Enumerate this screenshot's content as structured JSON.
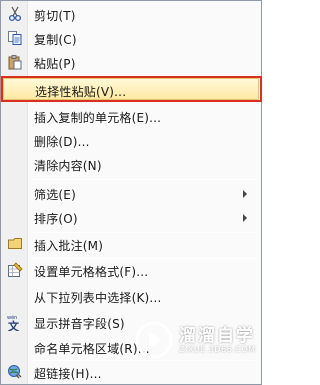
{
  "menu": {
    "cut": "剪切(T)",
    "copy": "复制(C)",
    "paste": "粘贴(P)",
    "paste_special": "选择性粘贴(V)...",
    "insert_copied": "插入复制的单元格(E)...",
    "delete": "删除(D)...",
    "clear_contents": "清除内容(N)",
    "filter": "筛选(E)",
    "sort": "排序(O)",
    "insert_comment": "插入批注(M)",
    "format_cells": "设置单元格格式(F)...",
    "pick_from_list": "从下拉列表中选择(K)...",
    "phonetic": "显示拼音字段(S)",
    "define_name": "命名单元格区域(R)...",
    "hyperlink": "超链接(H)..."
  },
  "watermark": {
    "title": "溜溜自学",
    "url": "ZIXUE.3D66.COM"
  },
  "colors": {
    "highlight_border": "#d93024",
    "hover_fill": "#ffe9a3"
  }
}
